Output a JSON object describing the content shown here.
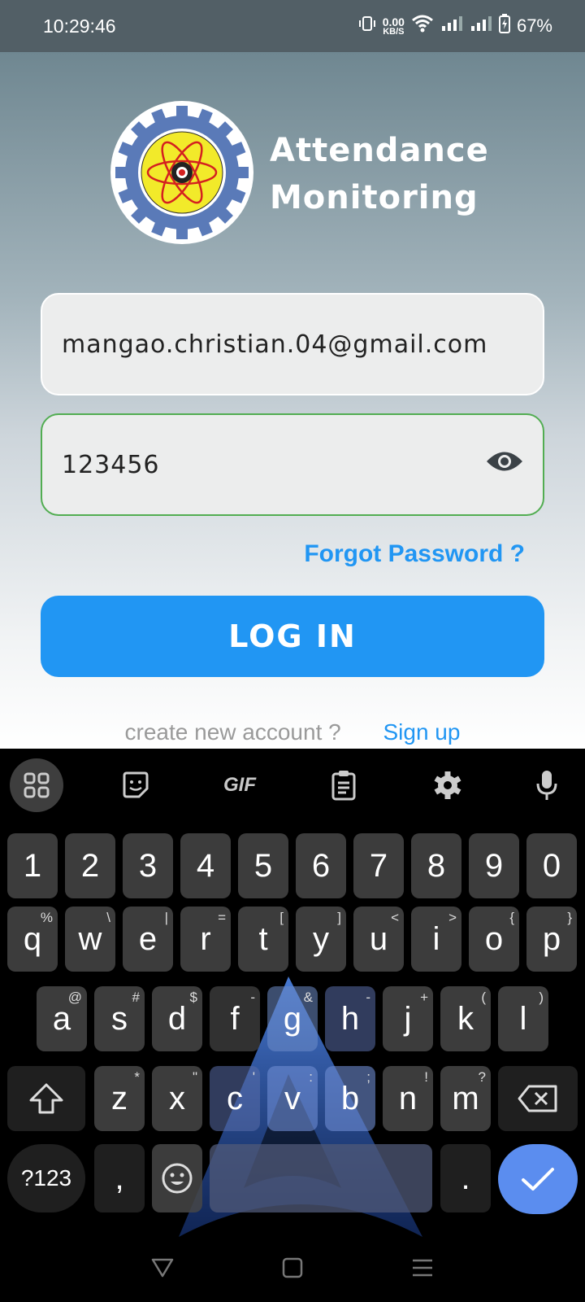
{
  "status_bar": {
    "time": "10:29:46",
    "net_speed_value": "0.00",
    "net_speed_unit": "KB/S",
    "battery": "67%"
  },
  "app": {
    "title_line1": "Attendance",
    "title_line2": "Monitoring",
    "logo_icon": "college-seal-logo",
    "email_value": "mangao.christian.04@gmail.com",
    "password_value": "123456",
    "forgot_label": "Forgot Password ?",
    "login_label": "LOG IN",
    "create_account_prompt": "create new account ?",
    "signup_label": "Sign up",
    "accent_color": "#2196f3",
    "valid_border_color": "#52ad52"
  },
  "keyboard": {
    "toolbar": [
      "apps-grid-icon",
      "sticker-icon",
      "GIF",
      "clipboard-icon",
      "gear-icon",
      "microphone-icon"
    ],
    "gif_label": "GIF",
    "row_numbers": [
      "1",
      "2",
      "3",
      "4",
      "5",
      "6",
      "7",
      "8",
      "9",
      "0"
    ],
    "row1": [
      {
        "k": "q",
        "h": "%"
      },
      {
        "k": "w",
        "h": "\\"
      },
      {
        "k": "e",
        "h": "|"
      },
      {
        "k": "r",
        "h": "="
      },
      {
        "k": "t",
        "h": "["
      },
      {
        "k": "y",
        "h": "]"
      },
      {
        "k": "u",
        "h": "<"
      },
      {
        "k": "i",
        "h": ">"
      },
      {
        "k": "o",
        "h": "{"
      },
      {
        "k": "p",
        "h": "}"
      }
    ],
    "row2": [
      {
        "k": "a",
        "h": "@"
      },
      {
        "k": "s",
        "h": "#"
      },
      {
        "k": "d",
        "h": "$"
      },
      {
        "k": "f",
        "h": "-"
      },
      {
        "k": "g",
        "h": "&"
      },
      {
        "k": "h",
        "h": "-"
      },
      {
        "k": "j",
        "h": "+"
      },
      {
        "k": "k",
        "h": "("
      },
      {
        "k": "l",
        "h": ")"
      }
    ],
    "row3": [
      {
        "k": "z",
        "h": "*"
      },
      {
        "k": "x",
        "h": "\""
      },
      {
        "k": "c",
        "h": "'"
      },
      {
        "k": "v",
        "h": ":"
      },
      {
        "k": "b",
        "h": ";"
      },
      {
        "k": "n",
        "h": "!"
      },
      {
        "k": "m",
        "h": "?"
      }
    ],
    "symbols_label": "?123",
    "comma_label": ",",
    "period_label": "."
  },
  "nav": {
    "back_icon": "triangle-back-icon",
    "home_icon": "square-home-icon",
    "recents_icon": "menu-recents-icon"
  }
}
